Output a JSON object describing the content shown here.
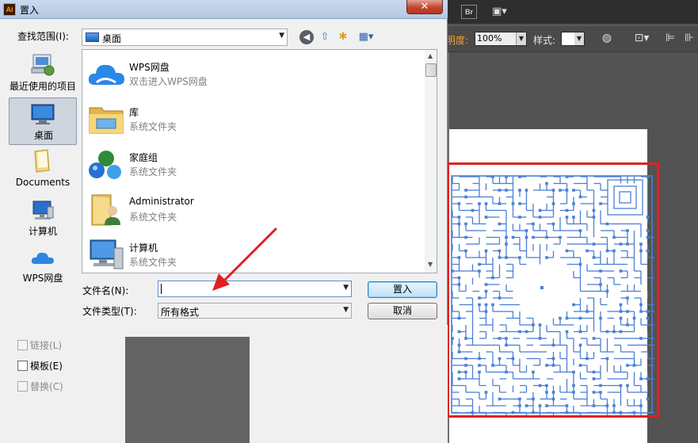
{
  "dialog": {
    "title": "置入",
    "close_glyph": "✕",
    "look_in_label": "查找范围(I):",
    "look_in_value": "桌面",
    "places": [
      {
        "label": "最近使用的项目"
      },
      {
        "label": "桌面"
      },
      {
        "label": "Documents"
      },
      {
        "label": "计算机"
      },
      {
        "label": "WPS网盘"
      }
    ],
    "files": [
      {
        "name": "WPS网盘",
        "desc": "双击进入WPS网盘"
      },
      {
        "name": "库",
        "desc": "系统文件夹"
      },
      {
        "name": "家庭组",
        "desc": "系统文件夹"
      },
      {
        "name": "Administrator",
        "desc": "系统文件夹"
      },
      {
        "name": "计算机",
        "desc": "系统文件夹"
      }
    ],
    "filename_label": "文件名(N):",
    "filename_value": "",
    "filetype_label": "文件类型(T):",
    "filetype_value": "所有格式",
    "place_button": "置入",
    "cancel_button": "取消",
    "options": [
      {
        "label": "链接(L)",
        "enabled": false,
        "checked": false
      },
      {
        "label": "模板(E)",
        "enabled": true,
        "checked": false
      },
      {
        "label": "替换(C)",
        "enabled": false,
        "checked": false
      }
    ]
  },
  "app": {
    "bridge_icon_text": "Br",
    "opacity_label": "明度:",
    "opacity_value": "100%",
    "style_label": "样式:"
  },
  "colors": {
    "annotation_red": "#e02020",
    "maze_blue": "#4a7fd6",
    "dialog_bg": "#f0f0f0",
    "app_bg": "#535353"
  }
}
